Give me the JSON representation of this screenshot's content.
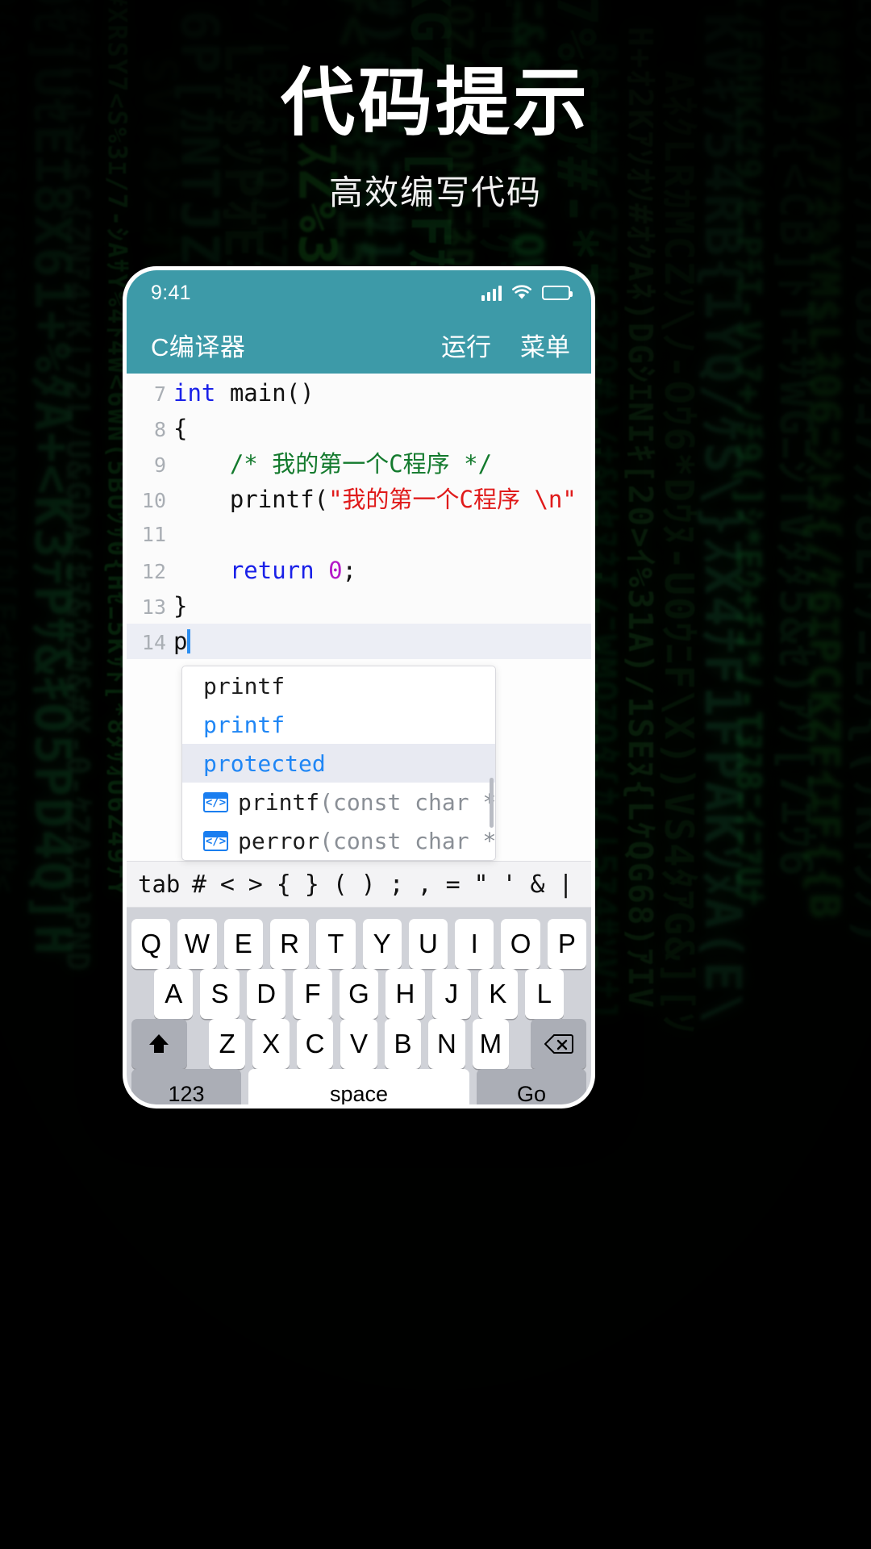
{
  "promo": {
    "headline": "代码提示",
    "subhead": "高效编写代码"
  },
  "colors": {
    "accent": "#3d9aa8",
    "keyword": "#1a21e8",
    "comment": "#137a2d",
    "string": "#e01b1b",
    "number": "#b418c8",
    "autocomplete_blue": "#1f86f5",
    "keyboard_bg": "#d0d2d8",
    "matrix_green": "#28aa46"
  },
  "phone": {
    "statusbar": {
      "time": "9:41",
      "icons": [
        "signal-icon",
        "wifi-icon",
        "battery-icon"
      ]
    },
    "appbar": {
      "title": "C编译器",
      "actions": [
        {
          "label": "运行",
          "name": "run-button"
        },
        {
          "label": "菜单",
          "name": "menu-button"
        }
      ]
    },
    "editor": {
      "lines": [
        {
          "num": "7",
          "segments": [
            {
              "t": "int",
              "c": "kw"
            },
            {
              "t": " main()",
              "c": "plain"
            }
          ]
        },
        {
          "num": "8",
          "segments": [
            {
              "t": "{",
              "c": "plain"
            }
          ]
        },
        {
          "num": "9",
          "segments": [
            {
              "t": "    ",
              "c": "plain"
            },
            {
              "t": "/* 我的第一个C程序 */",
              "c": "com"
            }
          ]
        },
        {
          "num": "10",
          "segments": [
            {
              "t": "    printf(",
              "c": "plain"
            },
            {
              "t": "\"我的第一个C程序 \\n\"",
              "c": "str"
            },
            {
              "t": " );",
              "c": "plain"
            }
          ]
        },
        {
          "num": "11",
          "segments": []
        },
        {
          "num": "12",
          "segments": [
            {
              "t": "    ",
              "c": "plain"
            },
            {
              "t": "return",
              "c": "kw"
            },
            {
              "t": " ",
              "c": "plain"
            },
            {
              "t": "0",
              "c": "num"
            },
            {
              "t": ";",
              "c": "plain"
            }
          ]
        },
        {
          "num": "13",
          "segments": [
            {
              "t": "}",
              "c": "plain"
            }
          ]
        },
        {
          "num": "14",
          "segments": [
            {
              "t": "p",
              "c": "plain"
            }
          ],
          "current": true,
          "caret": true
        }
      ]
    },
    "autocomplete": {
      "items": [
        {
          "label": "printf",
          "style": "plain",
          "icon": null,
          "selected": false
        },
        {
          "label": "printf",
          "style": "blue",
          "icon": null,
          "selected": false
        },
        {
          "label": "protected",
          "style": "blue",
          "icon": null,
          "selected": true
        },
        {
          "name": "printf",
          "signature": "(const char *f…",
          "style": "plain",
          "icon": "code-snippet-icon",
          "selected": false
        },
        {
          "name": "perror",
          "signature": "(const char *s…",
          "style": "plain",
          "icon": "code-snippet-icon",
          "selected": false
        }
      ]
    },
    "symbol_bar": [
      "tab",
      "#",
      "<",
      ">",
      "{",
      "}",
      "(",
      ")",
      ";",
      ",",
      "=",
      "\"",
      "'",
      "&",
      "|"
    ],
    "keyboard": {
      "row1": [
        "Q",
        "W",
        "E",
        "R",
        "T",
        "Y",
        "U",
        "I",
        "O",
        "P"
      ],
      "row2": [
        "A",
        "S",
        "D",
        "F",
        "G",
        "H",
        "J",
        "K",
        "L"
      ],
      "row3_shift": "shift-icon",
      "row3": [
        "Z",
        "X",
        "C",
        "V",
        "B",
        "N",
        "M"
      ],
      "row3_delete": "backspace-icon",
      "row4": {
        "numeric": "123",
        "space": "space",
        "go": "Go"
      }
    }
  },
  "matrix": {
    "glyphs": "ｱｲｳｴｵｶｷｸｹｺｻｼｽｾｿﾀﾁﾂﾃﾄﾅﾆﾇﾈﾉ0123456789ABCDEFGHIJKLMNOPQRSTUVWXYZ#$%&*+-<>{}[]()/\\|"
  }
}
